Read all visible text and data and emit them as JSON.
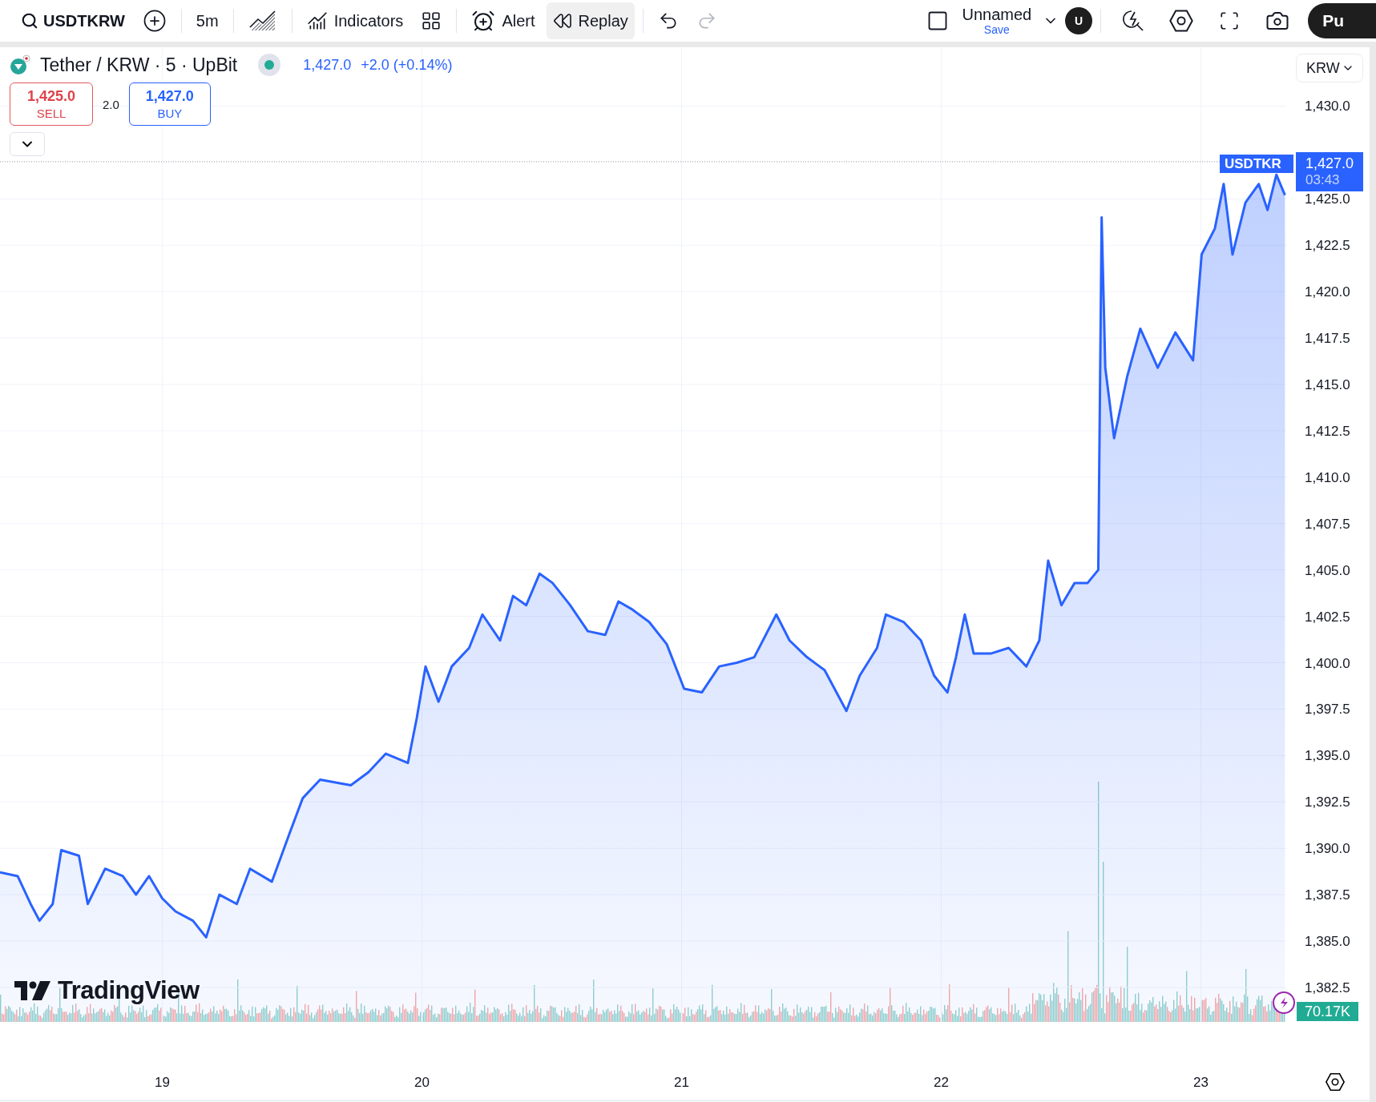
{
  "toolbar": {
    "left_groups": [
      [
        {
          "kind": "symbol",
          "label": "USDTKRW",
          "active": false,
          "disabled": false
        },
        {
          "kind": "add",
          "active": false,
          "disabled": false
        }
      ],
      [
        {
          "kind": "interval",
          "label": "5m",
          "active": false,
          "disabled": false
        }
      ],
      [
        {
          "kind": "chart-type",
          "active": false,
          "disabled": false
        }
      ],
      [
        {
          "kind": "indicators",
          "label": "Indicators",
          "active": false,
          "disabled": false
        },
        {
          "kind": "layouts",
          "active": false,
          "disabled": false
        }
      ],
      [
        {
          "kind": "alert",
          "label": "Alert",
          "active": false,
          "disabled": false
        },
        {
          "kind": "replay",
          "label": "Replay",
          "active": true,
          "disabled": false
        }
      ],
      [
        {
          "kind": "undo",
          "active": false,
          "disabled": false
        },
        {
          "kind": "redo",
          "active": false,
          "disabled": true
        }
      ]
    ],
    "layout": {
      "name": "Unnamed",
      "save": "Save"
    },
    "avatar": "U",
    "right_tools": [
      {
        "kind": "quick-search"
      },
      {
        "kind": "settings"
      },
      {
        "kind": "fullscreen"
      },
      {
        "kind": "snapshot"
      }
    ],
    "publish": "Pu"
  },
  "legend": {
    "title": "Tether / KRW · 5 · UpBit",
    "price": "1,427.0",
    "change": "+2.0 (+0.14%)",
    "sell": {
      "price": "1,425.0",
      "label": "SELL"
    },
    "spread": "2.0",
    "buy": {
      "price": "1,427.0",
      "label": "BUY"
    }
  },
  "currency": "KRW",
  "chart": {
    "chart_data": {
      "type": "area",
      "grid": true,
      "ref_lines": [
        {
          "axis": "y",
          "value": 1427,
          "label": "1,427.0"
        }
      ],
      "xlim": [
        18.375,
        23.65
      ],
      "ylim": [
        1376.37,
        1433.17
      ],
      "xticks": [
        {
          "value": 19,
          "label": "19"
        },
        {
          "value": 20,
          "label": "20"
        },
        {
          "value": 21,
          "label": "21"
        },
        {
          "value": 22,
          "label": "22"
        },
        {
          "value": 23,
          "label": "23"
        }
      ],
      "yticks": [
        {
          "value": 1430,
          "label": "1,430.0"
        },
        {
          "value": 1425,
          "label": "1,425.0"
        },
        {
          "value": 1422.5,
          "label": "1,422.5"
        },
        {
          "value": 1420,
          "label": "1,420.0"
        },
        {
          "value": 1417.5,
          "label": "1,417.5"
        },
        {
          "value": 1415,
          "label": "1,415.0"
        },
        {
          "value": 1412.5,
          "label": "1,412.5"
        },
        {
          "value": 1410,
          "label": "1,410.0"
        },
        {
          "value": 1407.5,
          "label": "1,407.5"
        },
        {
          "value": 1405,
          "label": "1,405.0"
        },
        {
          "value": 1402.5,
          "label": "1,402.5"
        },
        {
          "value": 1400,
          "label": "1,400.0"
        },
        {
          "value": 1397.5,
          "label": "1,397.5"
        },
        {
          "value": 1395,
          "label": "1,395.0"
        },
        {
          "value": 1392.5,
          "label": "1,392.5"
        },
        {
          "value": 1390,
          "label": "1,390.0"
        },
        {
          "value": 1387.5,
          "label": "1,387.5"
        },
        {
          "value": 1385,
          "label": "1,385.0"
        },
        {
          "value": 1382.5,
          "label": "1,382.5"
        }
      ],
      "x": [
        18.375,
        18.443,
        18.493,
        18.527,
        18.578,
        18.611,
        18.679,
        18.713,
        18.78,
        18.848,
        18.899,
        18.949,
        19.0,
        19.051,
        19.118,
        19.169,
        19.22,
        19.287,
        19.338,
        19.422,
        19.49,
        19.541,
        19.608,
        19.726,
        19.794,
        19.861,
        19.946,
        19.98,
        20.014,
        20.064,
        20.115,
        20.182,
        20.233,
        20.301,
        20.351,
        20.402,
        20.453,
        20.503,
        20.571,
        20.639,
        20.706,
        20.757,
        20.807,
        20.875,
        20.943,
        21.01,
        21.078,
        21.145,
        21.213,
        21.28,
        21.365,
        21.416,
        21.483,
        21.551,
        21.635,
        21.686,
        21.753,
        21.787,
        21.855,
        21.922,
        21.973,
        22.024,
        22.057,
        22.091,
        22.125,
        22.193,
        22.26,
        22.328,
        22.378,
        22.412,
        22.463,
        22.514,
        22.564,
        22.605,
        22.618,
        22.632,
        22.666,
        22.716,
        22.767,
        22.834,
        22.902,
        22.97,
        23.003,
        23.054,
        23.088,
        23.122,
        23.172,
        23.223,
        23.257,
        23.291,
        23.324
      ],
      "series": [
        {
          "color": "#2962ff",
          "values": [
            1388.7,
            1388.5,
            1387.0,
            1386.1,
            1387.0,
            1389.9,
            1389.6,
            1387.0,
            1388.9,
            1388.5,
            1387.5,
            1388.5,
            1387.3,
            1386.6,
            1386.1,
            1385.2,
            1387.5,
            1387.0,
            1388.9,
            1388.2,
            1390.8,
            1392.7,
            1393.7,
            1393.4,
            1394.1,
            1395.1,
            1394.6,
            1397.0,
            1399.8,
            1397.9,
            1399.8,
            1400.8,
            1402.6,
            1401.2,
            1403.6,
            1403.1,
            1404.8,
            1404.3,
            1403.1,
            1401.7,
            1401.5,
            1403.3,
            1402.9,
            1402.2,
            1401.0,
            1398.6,
            1398.4,
            1399.8,
            1400.0,
            1400.3,
            1402.6,
            1401.2,
            1400.3,
            1399.6,
            1397.4,
            1399.3,
            1400.8,
            1402.6,
            1402.2,
            1401.2,
            1399.3,
            1398.4,
            1400.3,
            1402.6,
            1400.5,
            1400.5,
            1400.8,
            1399.8,
            1401.2,
            1405.5,
            1403.1,
            1404.3,
            1404.3,
            1405.0,
            1424.0,
            1415.9,
            1412.1,
            1415.4,
            1418.0,
            1415.9,
            1417.8,
            1416.3,
            1422.0,
            1423.4,
            1425.8,
            1422.0,
            1424.8,
            1425.8,
            1424.4,
            1426.3,
            1425.2
          ]
        }
      ]
    },
    "last_price_tag": {
      "symbol": "USDTKR",
      "countdown": "03:43"
    },
    "volume_tag": "70.17K",
    "logo": "TradingView"
  }
}
